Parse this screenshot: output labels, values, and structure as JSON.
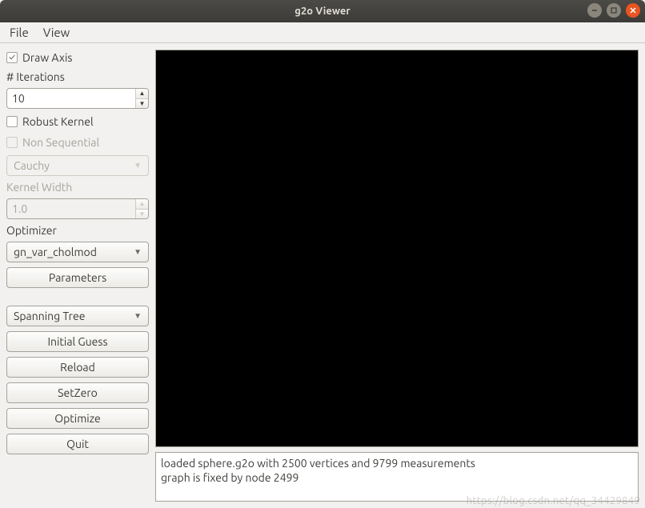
{
  "window": {
    "title": "g2o Viewer"
  },
  "menubar": {
    "file": "File",
    "view": "View"
  },
  "sidebar": {
    "draw_axis_label": "Draw Axis",
    "draw_axis_checked": "true",
    "iterations_label": "# Iterations",
    "iterations_value": "10",
    "robust_kernel_label": "Robust Kernel",
    "robust_kernel_checked": "false",
    "non_sequential_label": "Non Sequential",
    "non_sequential_checked": "false",
    "kernel_type_value": "Cauchy",
    "kernel_width_label": "Kernel Width",
    "kernel_width_value": "1.0",
    "optimizer_label": "Optimizer",
    "optimizer_value": "gn_var_cholmod",
    "parameters_btn": "Parameters",
    "init_method_value": "Spanning Tree",
    "initial_guess_btn": "Initial Guess",
    "reload_btn": "Reload",
    "setzero_btn": "SetZero",
    "optimize_btn": "Optimize",
    "quit_btn": "Quit"
  },
  "status": {
    "line1": "loaded sphere.g2o with 2500 vertices and 9799 measurements",
    "line2": "graph is fixed by node 2499"
  },
  "watermark": "https://blog.csdn.net/qq_34429849"
}
